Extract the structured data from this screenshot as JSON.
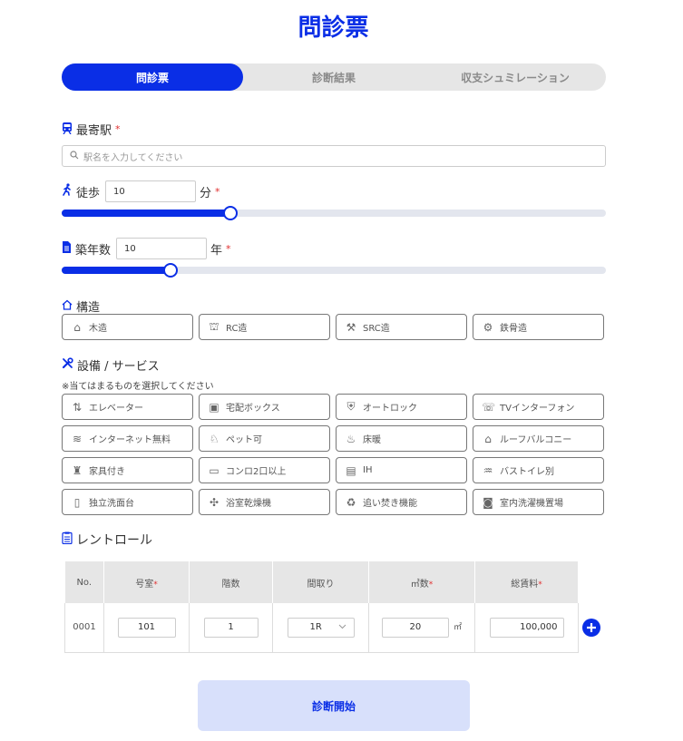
{
  "page_title": "問診票",
  "tabs": [
    {
      "label": "問診票",
      "active": true
    },
    {
      "label": "診断結果",
      "active": false
    },
    {
      "label": "収支シュミレーション",
      "active": false
    }
  ],
  "station": {
    "label": "最寄駅",
    "required_mark": "*",
    "placeholder": "駅名を入力してください",
    "icon": "train-icon"
  },
  "walk": {
    "label": "徒歩",
    "value": "10",
    "unit": "分",
    "required_mark": "*",
    "slider_fraction": 0.31,
    "icon": "walking-person-icon"
  },
  "age": {
    "label": "築年数",
    "value": "10",
    "unit": "年",
    "required_mark": "*",
    "slider_fraction": 0.2,
    "icon": "document-icon"
  },
  "structure": {
    "label": "構造",
    "icon": "house-icon",
    "options": [
      {
        "label": "木造",
        "icon": "house-outline-icon",
        "glyph": "⌂"
      },
      {
        "label": "RC造",
        "icon": "concrete-icon",
        "glyph": "⛫"
      },
      {
        "label": "SRC造",
        "icon": "crane-icon",
        "glyph": "⚒"
      },
      {
        "label": "鉄骨造",
        "icon": "steel-icon",
        "glyph": "⚙"
      }
    ]
  },
  "facilities": {
    "label": "設備 / サービス",
    "icon": "tools-icon",
    "note": "※当てはまるものを選択してください",
    "options": [
      {
        "label": "エレベーター",
        "icon": "elevator-icon",
        "glyph": "⇅"
      },
      {
        "label": "宅配ボックス",
        "icon": "delivery-box-icon",
        "glyph": "▣"
      },
      {
        "label": "オートロック",
        "icon": "shield-lock-icon",
        "glyph": "⛨"
      },
      {
        "label": "TVインターフォン",
        "icon": "intercom-icon",
        "glyph": "☏"
      },
      {
        "label": "インターネット無料",
        "icon": "wifi-icon",
        "glyph": "≋"
      },
      {
        "label": "ペット可",
        "icon": "pet-icon",
        "glyph": "♘"
      },
      {
        "label": "床暖",
        "icon": "floor-heating-icon",
        "glyph": "♨"
      },
      {
        "label": "ルーフバルコニー",
        "icon": "roof-balcony-icon",
        "glyph": "⌂"
      },
      {
        "label": "家具付き",
        "icon": "furniture-icon",
        "glyph": "♜"
      },
      {
        "label": "コンロ2口以上",
        "icon": "stove-icon",
        "glyph": "▭"
      },
      {
        "label": "IH",
        "icon": "ih-cooker-icon",
        "glyph": "▤"
      },
      {
        "label": "バストイレ別",
        "icon": "bathtub-icon",
        "glyph": "♒"
      },
      {
        "label": "独立洗面台",
        "icon": "washbasin-icon",
        "glyph": "▯"
      },
      {
        "label": "浴室乾燥機",
        "icon": "fan-icon",
        "glyph": "✣"
      },
      {
        "label": "追い焚き機能",
        "icon": "reheat-icon",
        "glyph": "♻"
      },
      {
        "label": "室内洗濯機置場",
        "icon": "washing-machine-icon",
        "glyph": "◙"
      }
    ]
  },
  "rent_roll": {
    "label": "レントロール",
    "icon": "clipboard-icon",
    "headers": {
      "no": "No.",
      "room": "号室",
      "floor": "階数",
      "layout": "間取り",
      "area": "㎡数",
      "rent": "総賃料",
      "required_mark": "*"
    },
    "rows": [
      {
        "no": "0001",
        "room": "101",
        "floor": "1",
        "layout": "1R",
        "area": "20",
        "area_unit": "㎡",
        "rent": "100,000"
      }
    ]
  },
  "submit_label": "診断開始",
  "colors": {
    "primary": "#0a2ee6",
    "tab_bg": "#e6e6e6",
    "submit_bg": "#d8e0fb",
    "required": "#e03030"
  }
}
